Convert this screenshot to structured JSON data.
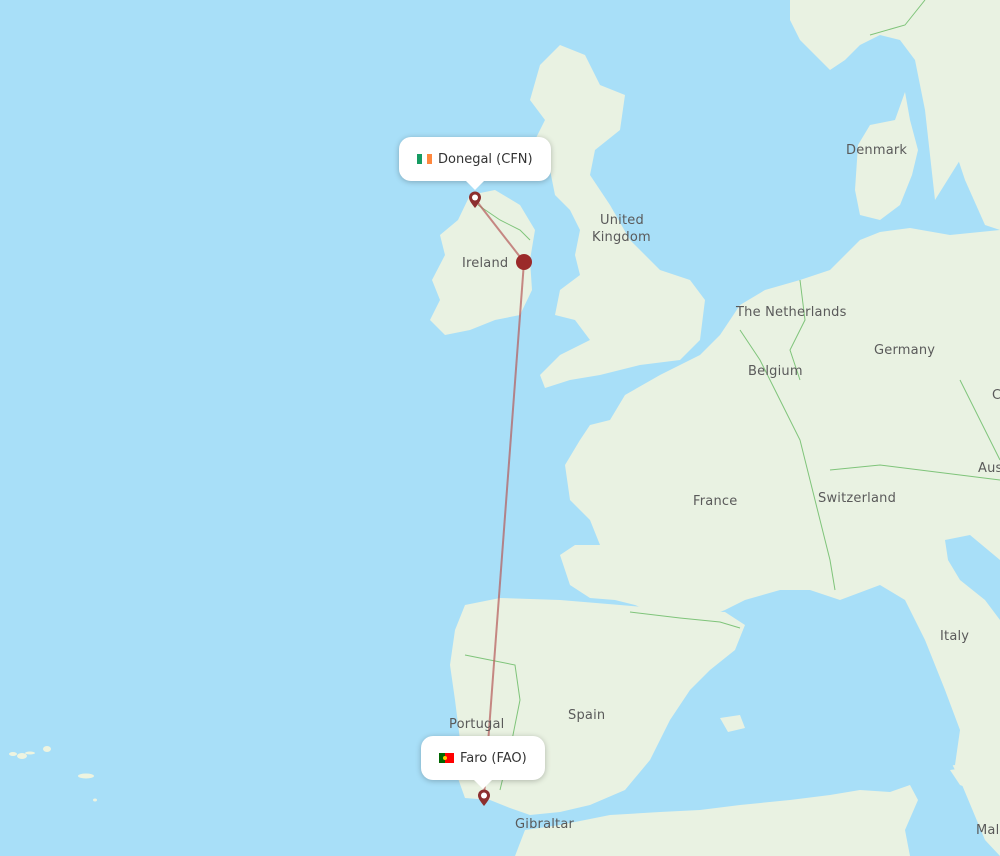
{
  "map": {
    "colors": {
      "water": "#a8dff8",
      "land": "#e9f2e2",
      "border": "#7fc47a",
      "route": "#b55a5a",
      "pin": "#8c2f2f",
      "waypoint": "#9b2a2a"
    },
    "country_labels": [
      {
        "id": "denmark",
        "text": "Denmark"
      },
      {
        "id": "united-kingdom-1",
        "text": "United"
      },
      {
        "id": "united-kingdom-2",
        "text": "Kingdom"
      },
      {
        "id": "ireland",
        "text": "Ireland"
      },
      {
        "id": "netherlands",
        "text": "The Netherlands"
      },
      {
        "id": "germany",
        "text": "Germany"
      },
      {
        "id": "belgium",
        "text": "Belgium"
      },
      {
        "id": "france",
        "text": "France"
      },
      {
        "id": "switzerland",
        "text": "Switzerland"
      },
      {
        "id": "austria",
        "text": "Aus"
      },
      {
        "id": "czech",
        "text": "C"
      },
      {
        "id": "italy",
        "text": "Italy"
      },
      {
        "id": "portugal",
        "text": "Portugal"
      },
      {
        "id": "spain",
        "text": "Spain"
      },
      {
        "id": "gibraltar",
        "text": "Gibraltar"
      },
      {
        "id": "malta",
        "text": "Mal"
      }
    ],
    "origin": {
      "name": "Donegal (CFN)",
      "flag": "ireland-flag",
      "icon": "map-pin-icon"
    },
    "destination": {
      "name": "Faro (FAO)",
      "flag": "portugal-flag",
      "icon": "map-pin-icon"
    },
    "route": {
      "stops": 1,
      "waypoint_icon": "waypoint-dot-icon"
    }
  }
}
